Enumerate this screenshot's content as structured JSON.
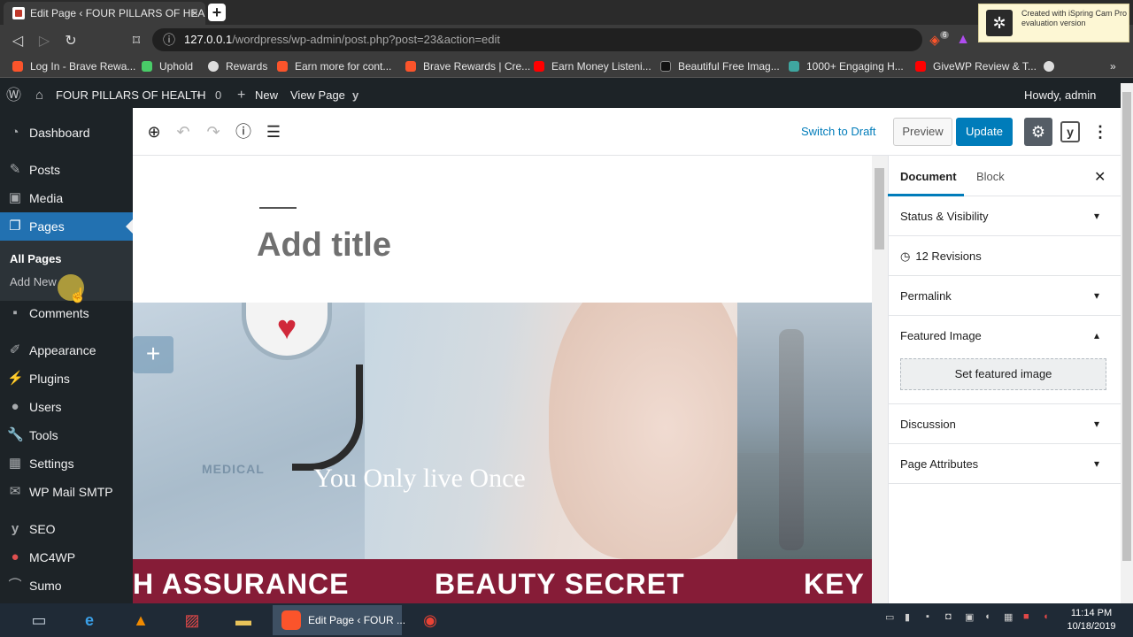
{
  "browser": {
    "tab_title": "Edit Page ‹ FOUR PILLARS OF HEA",
    "tab_close": "×",
    "new_tab": "+",
    "url_host": "127.0.0.1",
    "url_path": "/wordpress/wp-admin/post.php?post=23&action=edit",
    "bookmarks": [
      {
        "label": "Log In - Brave Rewa...",
        "icon_color": "#fb542b"
      },
      {
        "label": "Uphold",
        "icon_color": "#49cc68"
      },
      {
        "label": "Rewards",
        "icon_color": "#dddddd"
      },
      {
        "label": "Earn more for cont...",
        "icon_color": "#fb542b"
      },
      {
        "label": "Brave Rewards | Cre...",
        "icon_color": "#fb542b"
      },
      {
        "label": "Earn Money Listeni...",
        "icon_color": "#ff0000"
      },
      {
        "label": "Beautiful Free Imag...",
        "icon_color": "#111111"
      },
      {
        "label": "1000+ Engaging H...",
        "icon_color": "#3fa6a0"
      },
      {
        "label": "GiveWP Review & T...",
        "icon_color": "#ff0000"
      }
    ],
    "overflow": "»",
    "brave_badge": "6"
  },
  "ispring": {
    "line1": "Created with iSpring Cam Pro",
    "line2": "evaluation version"
  },
  "adminbar": {
    "site_name": "FOUR PILLARS OF HEALTH",
    "comments_count": "0",
    "new_label": "New",
    "view_page": "View Page",
    "howdy": "Howdy, admin"
  },
  "sidebar": {
    "items": [
      {
        "label": "Dashboard",
        "icon": "dashboard-icon"
      },
      {
        "label": "Posts",
        "icon": "pin-icon"
      },
      {
        "label": "Media",
        "icon": "media-icon"
      },
      {
        "label": "Pages",
        "icon": "pages-icon"
      },
      {
        "label": "Comments",
        "icon": "comment-icon"
      },
      {
        "label": "Appearance",
        "icon": "brush-icon"
      },
      {
        "label": "Plugins",
        "icon": "plug-icon"
      },
      {
        "label": "Users",
        "icon": "user-icon"
      },
      {
        "label": "Tools",
        "icon": "wrench-icon"
      },
      {
        "label": "Settings",
        "icon": "settings-icon"
      },
      {
        "label": "WP Mail SMTP",
        "icon": "mail-icon"
      },
      {
        "label": "SEO",
        "icon": "yoast-icon"
      },
      {
        "label": "MC4WP",
        "icon": "mc4wp-icon"
      },
      {
        "label": "Sumo",
        "icon": "sumo-icon"
      }
    ],
    "submenu": [
      "All Pages",
      "Add New"
    ]
  },
  "editor": {
    "switch_to_draft": "Switch to Draft",
    "preview": "Preview",
    "update": "Update",
    "title_placeholder": "Add title",
    "cover_text": "You Only live Once",
    "cover_label": "MEDICAL",
    "banner": [
      "H ASSURANCE",
      "BEAUTY SECRET",
      "KEY T"
    ]
  },
  "panel": {
    "tabs": [
      "Document",
      "Block"
    ],
    "sections": {
      "status": "Status & Visibility",
      "revisions": "12 Revisions",
      "permalink": "Permalink",
      "featured": "Featured Image",
      "set_featured": "Set featured image",
      "discussion": "Discussion",
      "attributes": "Page Attributes"
    }
  },
  "taskbar": {
    "active_window": "Edit Page ‹ FOUR ...",
    "time": "11:14 PM",
    "date": "10/18/2019"
  }
}
